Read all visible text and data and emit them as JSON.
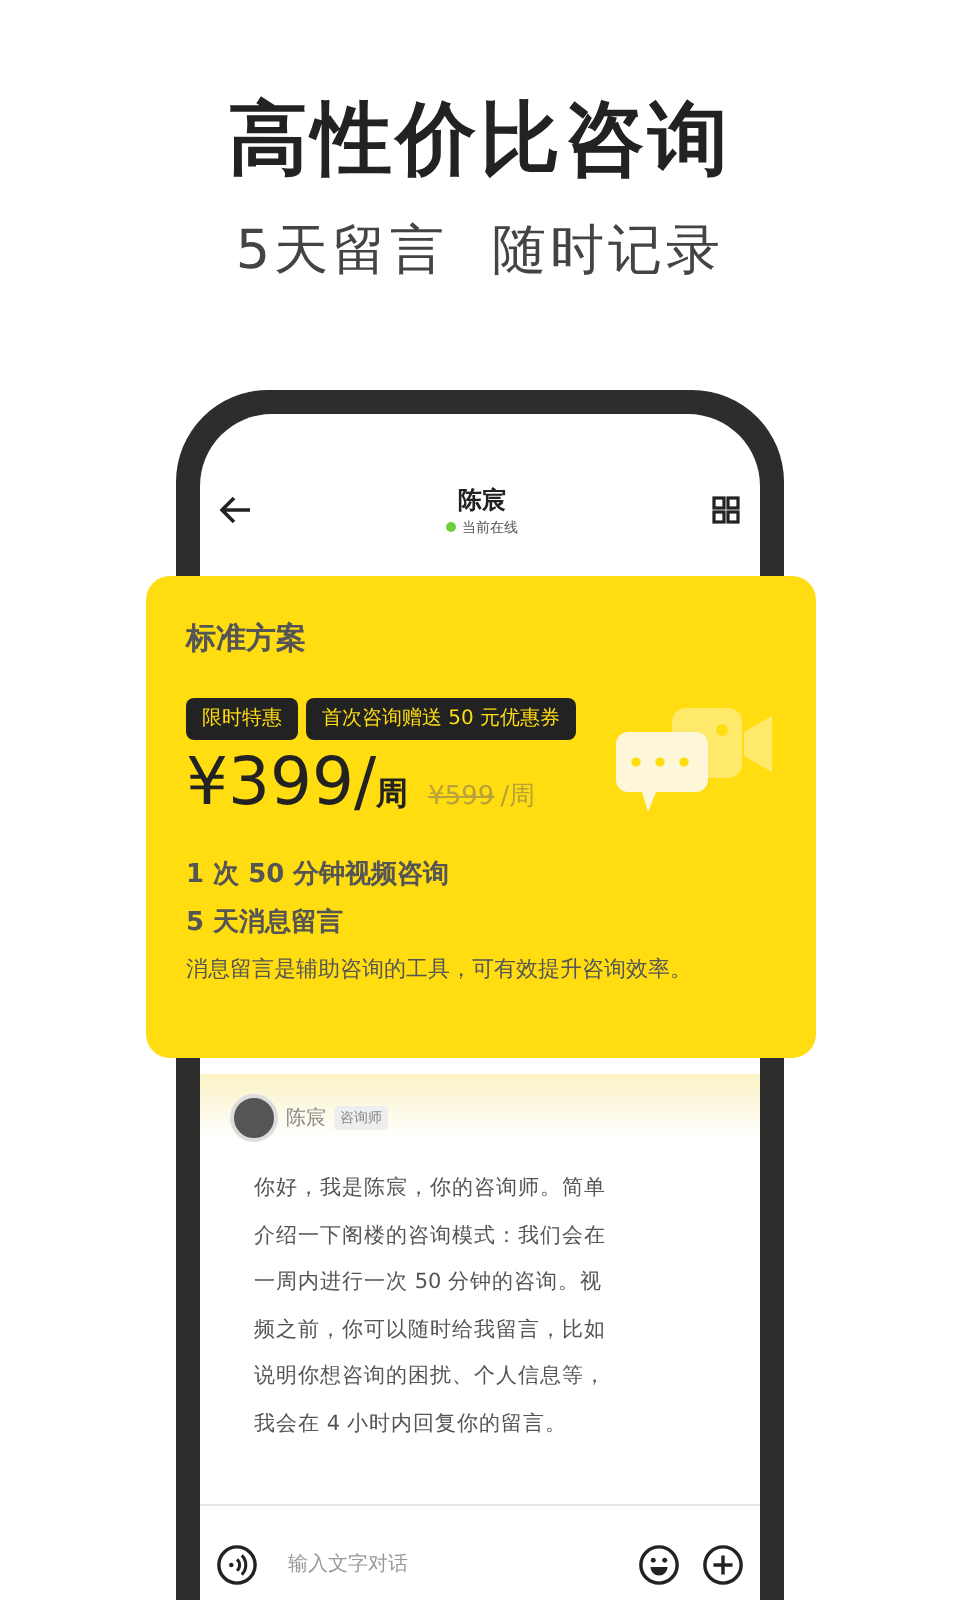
{
  "headline": "高性价比咨询",
  "subheadline": [
    "5天留言",
    "随时记录"
  ],
  "chat_header": {
    "name": "陈宸",
    "status": "当前在线",
    "online": true
  },
  "plan_card": {
    "title": "标准方案",
    "tags": [
      "限时特惠",
      "首次咨询赠送 50 元优惠券"
    ],
    "price": "¥399/",
    "price_unit": "周",
    "original_price": "¥599",
    "original_unit": "/周",
    "features": [
      "1 次 50 分钟视频咨询",
      "5 天消息留言"
    ],
    "note": "消息留言是辅助咨询的工具，可有效提升咨询效率。"
  },
  "message": {
    "sender": "陈宸",
    "role": "咨询师",
    "text": "你好，我是陈宸，你的咨询师。简单介绍一下阁楼的咨询模式：我们会在一周内进行一次 50 分钟的咨询。视频之前，你可以随时给我留言，比如说明你想咨询的困扰、个人信息等，我会在 4 小时内回复你的留言。"
  },
  "input_bar": {
    "placeholder": "输入文字对话"
  }
}
